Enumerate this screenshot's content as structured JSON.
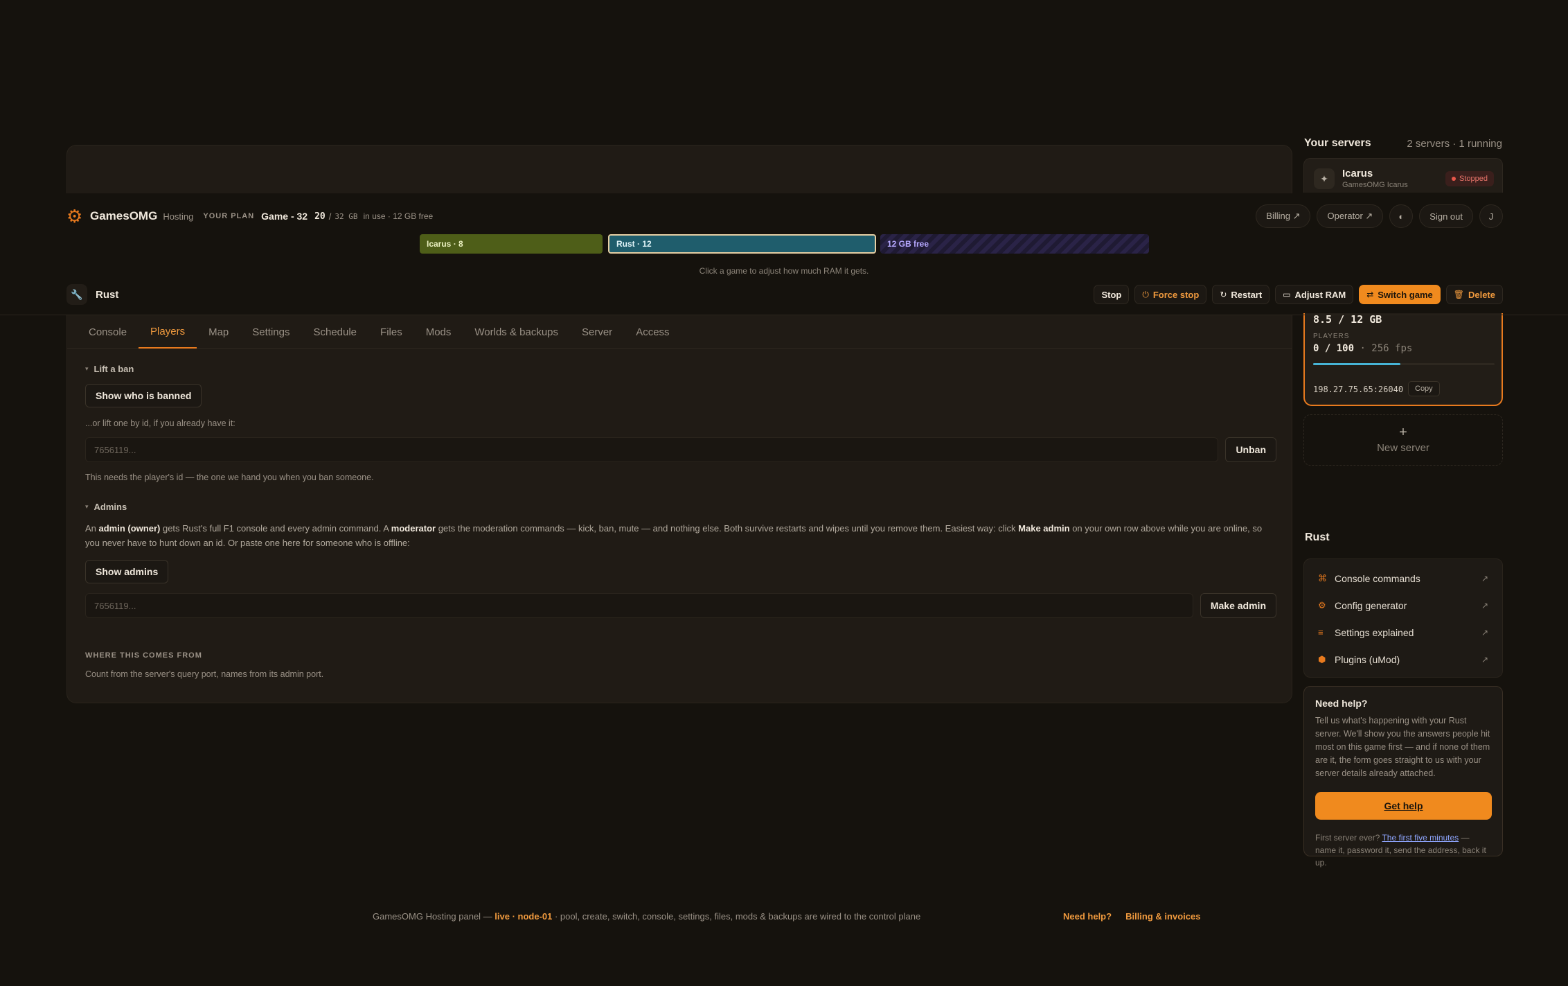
{
  "brand": {
    "name": "GamesOMG",
    "sub": "Hosting"
  },
  "plan": {
    "label": "YOUR PLAN",
    "name": "Game - 32",
    "used": "20",
    "sep": "/",
    "total": "32 GB",
    "free": "in use · 12 GB free"
  },
  "header_nav": {
    "billing": "Billing ↗",
    "operator": "Operator ↗",
    "theme": "◐",
    "signout": "Sign out",
    "avatar": "J"
  },
  "ram_bar": {
    "icarus": "Icarus · 8",
    "rust": "Rust · 12",
    "free": "12 GB free",
    "hint": "Click a game to adjust how much RAM it gets."
  },
  "game": {
    "title": "Rust",
    "actions": {
      "stop": "Stop",
      "force_stop": "Force stop",
      "restart": "Restart",
      "adjust_ram": "Adjust RAM",
      "switch_game": "Switch game",
      "delete": "Delete"
    }
  },
  "tabs": [
    "Console",
    "Players",
    "Map",
    "Settings",
    "Schedule",
    "Files",
    "Mods",
    "Worlds & backups",
    "Server",
    "Access"
  ],
  "players": {
    "lift_ban": {
      "heading": "Lift a ban",
      "show_banned": "Show who is banned",
      "or_text": "...or lift one by id, if you already have it:",
      "placeholder": "7656119...",
      "unban": "Unban",
      "help": "This needs the player's id — the one we hand you when you ban someone."
    },
    "admins": {
      "heading": "Admins",
      "p1": "An ",
      "b1": "admin (owner)",
      "p2": " gets Rust's full F1 console and every admin command. A ",
      "b2": "moderator",
      "p3": " gets the moderation commands — kick, ban, mute — and nothing else. Both survive restarts and wipes until you remove them. Easiest way: click ",
      "b3": "Make admin",
      "p4": " on your own row above while you are online, so you never have to hunt down an id. Or paste one here for someone who is offline:",
      "show_admins": "Show admins",
      "placeholder": "7656119...",
      "make_admin": "Make admin"
    },
    "source": {
      "heading": "WHERE THIS COMES FROM",
      "text": "Count from the server's query port, names from its admin port."
    }
  },
  "servers": {
    "title": "Your servers",
    "count": "2 servers · 1 running",
    "icarus": {
      "name": "Icarus",
      "sub": "GamesOMG Icarus",
      "status": "Stopped"
    },
    "rust": {
      "ram": "8.5 / 12 GB",
      "players_label": "PLAYERS",
      "players": "0 / 100",
      "fps": " · 256 fps",
      "player_fill": 0.48,
      "ip": "198.27.75.65:26040",
      "copy": "Copy"
    },
    "new_server": "New server",
    "new_plus": "+"
  },
  "rust_links": {
    "heading": "Rust",
    "items": [
      {
        "icon": "⌘",
        "label": "Console commands",
        "arrow": "↗"
      },
      {
        "icon": "⚙",
        "label": "Config generator",
        "arrow": "↗"
      },
      {
        "icon": "≡",
        "label": "Settings explained",
        "arrow": "↗"
      },
      {
        "icon": "⬢",
        "label": "Plugins (uMod)",
        "arrow": "↗"
      }
    ]
  },
  "help": {
    "title": "Need help?",
    "text": "Tell us what's happening with your Rust server. We'll show you the answers people hit most on this game first — and if none of them are it, the form goes straight to us with your server details already attached.",
    "button": "Get help",
    "foot_pre": "First server ever? ",
    "foot_link": "The first five minutes",
    "foot_post": " — name it, password it, send the address, back it up."
  },
  "footer": {
    "pre": "GamesOMG Hosting panel — ",
    "live": "live · node-01",
    "post": " · pool, create, switch, console, settings, files, mods & backups are wired to the control plane",
    "need_help": "Need help?",
    "billing": "Billing & invoices"
  }
}
